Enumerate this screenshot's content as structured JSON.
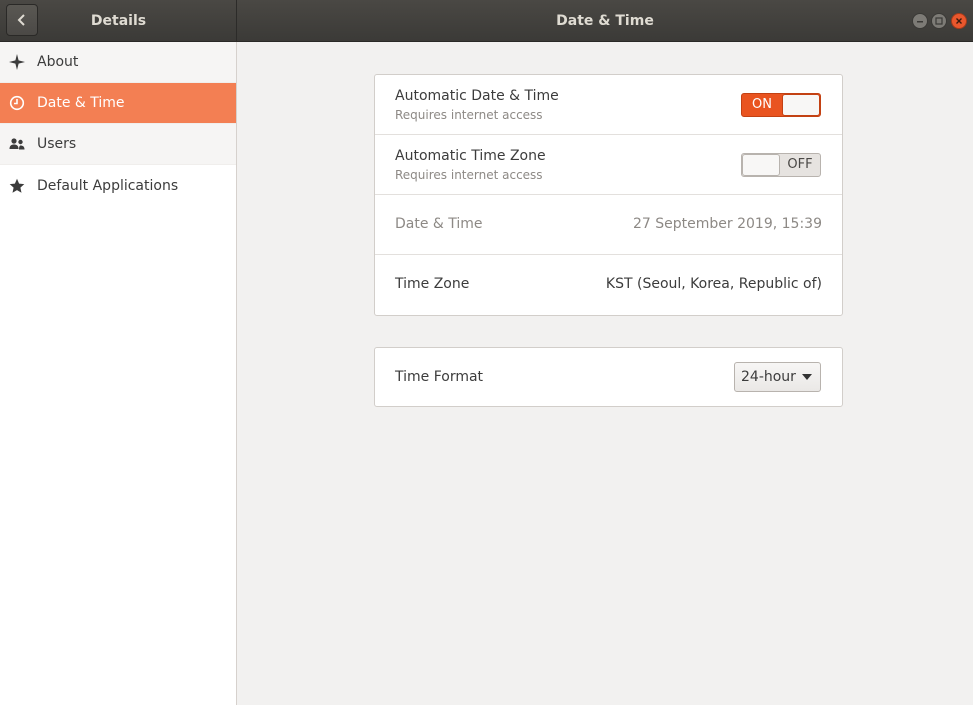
{
  "titlebar": {
    "left_title": "Details",
    "title": "Date & Time"
  },
  "sidebar": {
    "items": [
      {
        "label": "About",
        "icon": "sparkle-icon",
        "selected": false
      },
      {
        "label": "Date & Time",
        "icon": "clock-icon",
        "selected": true
      },
      {
        "label": "Users",
        "icon": "users-icon",
        "selected": false
      },
      {
        "label": "Default Applications",
        "icon": "star-icon",
        "selected": false
      }
    ]
  },
  "main": {
    "auto_datetime": {
      "title": "Automatic Date & Time",
      "subtitle": "Requires internet access",
      "switch_label": "ON",
      "enabled": true
    },
    "auto_timezone": {
      "title": "Automatic Time Zone",
      "subtitle": "Requires internet access",
      "switch_label": "OFF",
      "enabled": false
    },
    "datetime": {
      "title": "Date & Time",
      "value": "27 September 2019, 15:39"
    },
    "timezone": {
      "title": "Time Zone",
      "value": "KST (Seoul, Korea, Republic of)"
    },
    "time_format": {
      "title": "Time Format",
      "selected": "24-hour"
    }
  },
  "colors": {
    "accent": "#e95420",
    "selected_row": "#f37f53",
    "titlebar": "#3b3a37"
  }
}
